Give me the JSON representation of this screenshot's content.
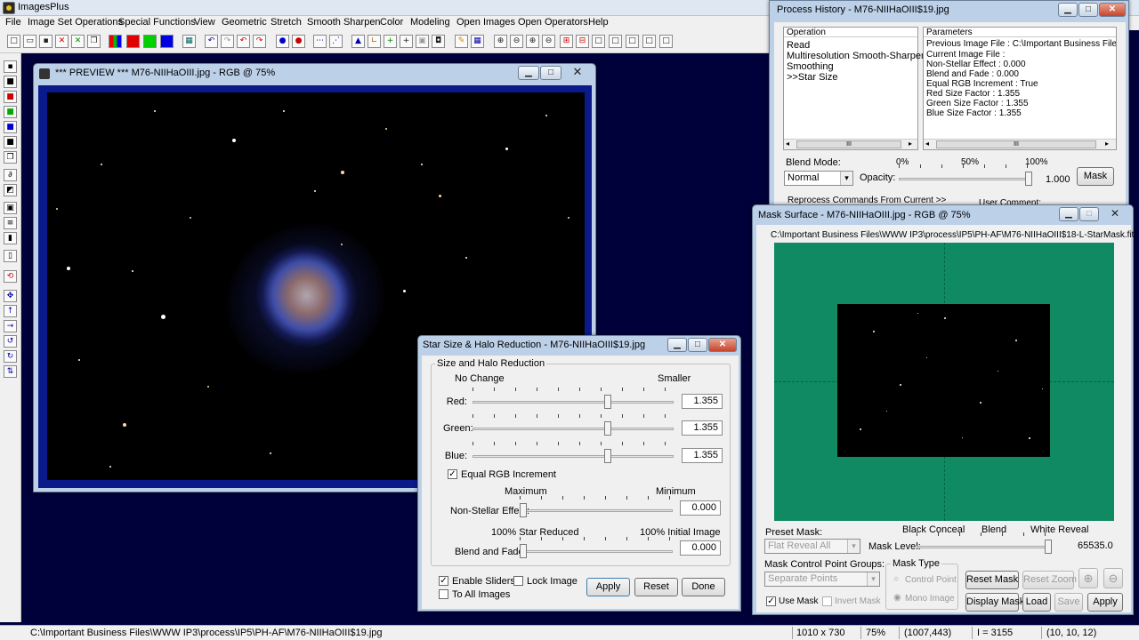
{
  "app": {
    "title": "ImagesPlus"
  },
  "menu": [
    "File",
    "Image Set Operations",
    "Special Functions",
    "View",
    "Geometric",
    "Stretch",
    "Smooth Sharpen",
    "Color",
    "Modeling",
    "Open Images",
    "Open Operators",
    "Help"
  ],
  "preview": {
    "title": "*** PREVIEW *** M76-NIIHaOIII.jpg - RGB @ 75%"
  },
  "history": {
    "title": "Process History - M76-NIIHaOIII$19.jpg",
    "operation_header": "Operation",
    "operations": [
      "Read",
      "Multiresolution Smooth-Sharpen",
      "Smoothing",
      ">>Star Size"
    ],
    "parameters_header": "Parameters",
    "parameters": [
      "Previous Image File : C:\\Important Business Files\\WW...",
      "Current Image File :",
      "Non-Stellar Effect : 0.000",
      "Blend and Fade : 0.000",
      "Equal RGB Increment : True",
      "Red Size Factor : 1.355",
      "Green Size Factor : 1.355",
      "Blue Size Factor : 1.355"
    ],
    "scroll_grip": "III",
    "blend_mode_label": "Blend Mode:",
    "blend_mode_value": "Normal",
    "opacity_label": "Opacity:",
    "pct0": "0%",
    "pct50": "50%",
    "pct100": "100%",
    "opacity_value": "1.000",
    "opacity_level": 1.0,
    "mask_button": "Mask",
    "reprocess_label": "Reprocess Commands From Current >>",
    "user_comment_label": "User Comment:"
  },
  "mask": {
    "title": "Mask Surface - M76-NIIHaOIII.jpg - RGB @ 75%",
    "path": "C:\\Important Business Files\\WWW IP3\\process\\IP5\\PH-AF\\M76-NIIHaOIII$18-L-StarMask.fit",
    "surface_color": "#0f8a62",
    "preset_mask_label": "Preset Mask:",
    "preset_mask_value": "Flat Reveal All",
    "black_conceal": "Black Conceal",
    "blend": "Blend",
    "white_reveal": "White Reveal",
    "mask_level_label": "Mask Level:",
    "mask_level_value": "65535.0",
    "mask_level_fraction": 1.0,
    "groups_label": "Mask Control Point Groups:",
    "groups_value": "Separate Points",
    "mask_type_label": "Mask Type",
    "control_point": "Control Point",
    "mono_image": "Mono Image",
    "reset_mask": "Reset Mask",
    "reset_zoom": "Reset Zoom",
    "use_mask": "Use Mask",
    "invert_mask": "Invert Mask",
    "display_mask": "Display Mask",
    "load": "Load",
    "save": "Save",
    "apply": "Apply"
  },
  "star": {
    "title": "Star Size & Halo Reduction - M76-NIIHaOIII$19.jpg",
    "group_label": "Size and Halo Reduction",
    "no_change": "No Change",
    "smaller": "Smaller",
    "sliders": [
      {
        "label": "Red:",
        "value": "1.355",
        "fraction": 0.68
      },
      {
        "label": "Green:",
        "value": "1.355",
        "fraction": 0.68
      },
      {
        "label": "Blue:",
        "value": "1.355",
        "fraction": 0.68
      }
    ],
    "equal_rgb": "Equal RGB Increment",
    "maximum": "Maximum",
    "minimum": "Minimum",
    "non_stellar_label": "Non-Stellar Effect:",
    "non_stellar_value": "0.000",
    "star_reduced": "100% Star Reduced",
    "initial_image": "100% Initial Image",
    "blend_fade_label": "Blend and Fade:",
    "blend_fade_value": "0.000",
    "enable_sliders": "Enable Sliders",
    "to_all_images": "To All Images",
    "lock_image": "Lock Image",
    "apply": "Apply",
    "reset": "Reset",
    "done": "Done"
  },
  "status": {
    "path": "C:\\Important Business Files\\WWW IP3\\process\\IP5\\PH-AF\\M76-NIIHaOIII$19.jpg",
    "size": "1010 x 730",
    "zoom": "75%",
    "coords": "(1007,443)",
    "intensity": "I = 3155",
    "rgb": "(10, 10, 12)"
  }
}
